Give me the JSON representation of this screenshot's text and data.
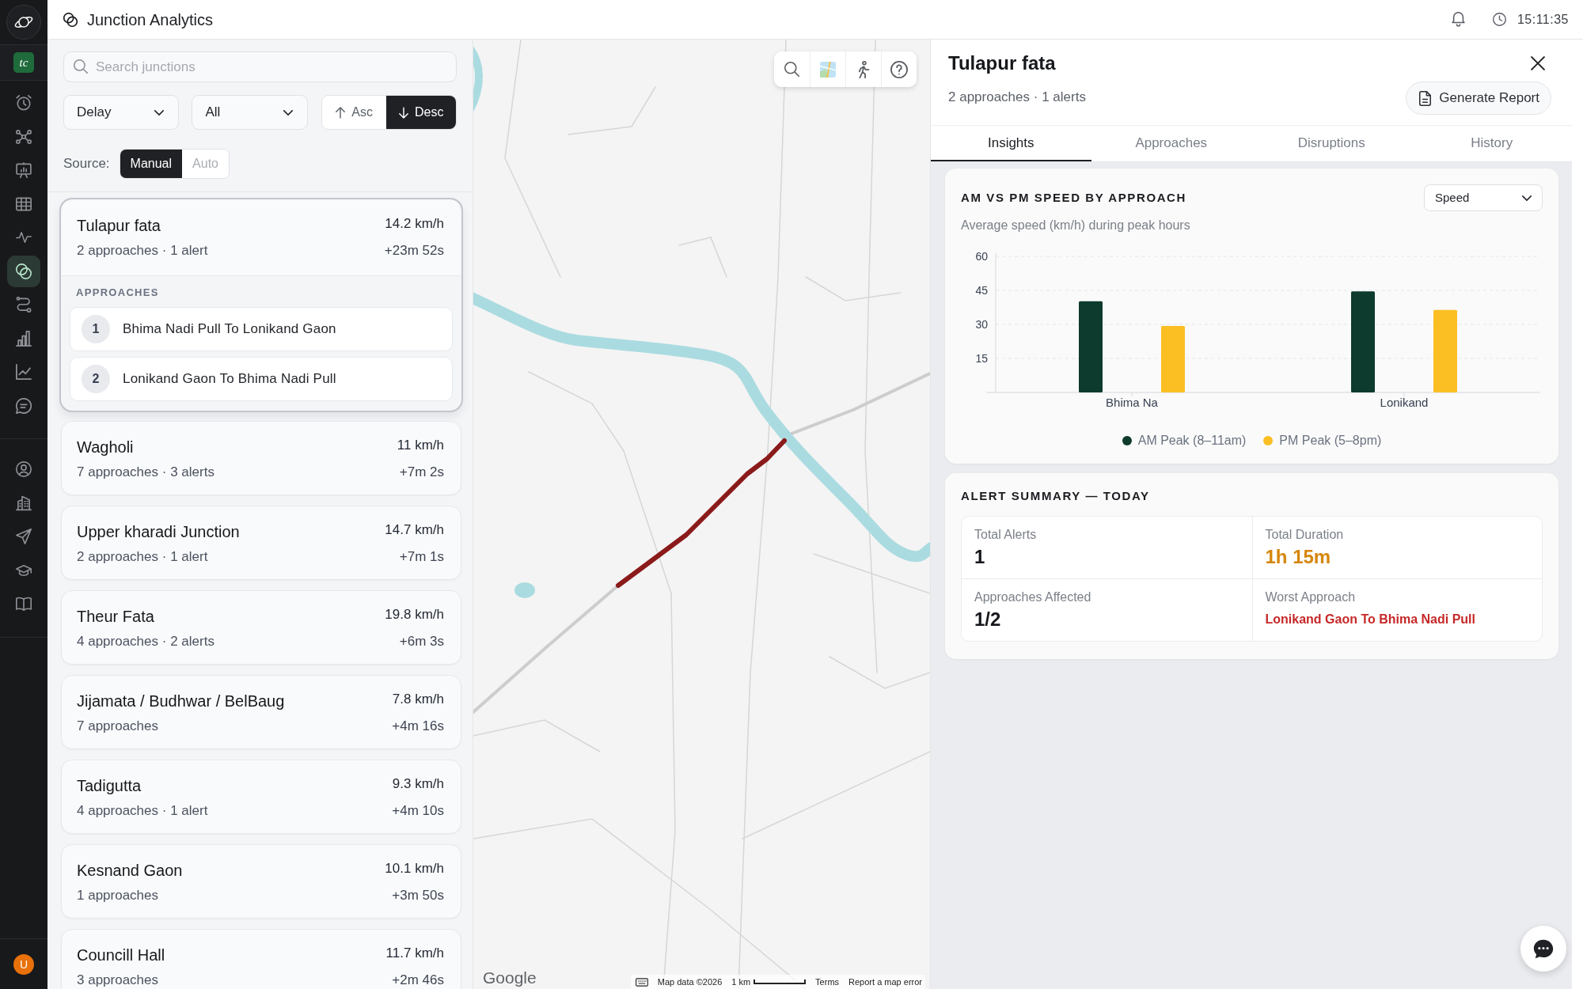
{
  "nav": {
    "workspace_badge": "tc",
    "groups": [
      {
        "items": [
          {
            "selected": false
          },
          {
            "selected": false
          },
          {
            "selected": false
          },
          {
            "selected": false
          },
          {
            "selected": false
          },
          {
            "selected": true
          },
          {
            "selected": false
          },
          {
            "selected": false
          },
          {
            "selected": false
          },
          {
            "selected": false
          }
        ]
      },
      {
        "items": [
          {
            "selected": false
          },
          {
            "selected": false
          },
          {
            "selected": false
          },
          {
            "selected": false
          },
          {
            "selected": false
          }
        ]
      }
    ],
    "avatar": "U"
  },
  "header": {
    "title": "Junction Analytics",
    "time": "15:11:35"
  },
  "junction_panel": {
    "search": {
      "placeholder": "Search junctions"
    },
    "filters": [
      {
        "value": "Delay"
      },
      {
        "value": "All"
      }
    ],
    "sort": [
      {
        "label": "Asc",
        "selected": false
      },
      {
        "label": "Desc",
        "selected": true
      }
    ],
    "source": {
      "label": "Source:",
      "options": [
        {
          "label": "Manual",
          "selected": true
        },
        {
          "label": "Auto",
          "selected": false
        }
      ]
    },
    "junctions": [
      {
        "name": "Tulapur fata",
        "summary": "2 approaches · 1 alert",
        "speed": "14.2 km/h",
        "delay": "+23m 52s",
        "selected": true,
        "approaches_heading": "APPROACHES",
        "approaches": [
          {
            "number": "1",
            "name": "Bhima Nadi Pull To Lonikand Gaon"
          },
          {
            "number": "2",
            "name": "Lonikand Gaon To Bhima Nadi Pull"
          }
        ]
      },
      {
        "name": "Wagholi",
        "summary": "7 approaches · 3 alerts",
        "speed": "11 km/h",
        "delay": "+7m 2s",
        "selected": false
      },
      {
        "name": "Upper kharadi Junction",
        "summary": "2 approaches · 1 alert",
        "speed": "14.7 km/h",
        "delay": "+7m 1s",
        "selected": false
      },
      {
        "name": "Theur Fata",
        "summary": "4 approaches · 2 alerts",
        "speed": "19.8 km/h",
        "delay": "+6m 3s",
        "selected": false
      },
      {
        "name": "Jijamata / Budhwar / BelBaug",
        "summary": "7 approaches",
        "speed": "7.8 km/h",
        "delay": "+4m 16s",
        "selected": false
      },
      {
        "name": "Tadigutta",
        "summary": "4 approaches · 1 alert",
        "speed": "9.3 km/h",
        "delay": "+4m 10s",
        "selected": false
      },
      {
        "name": "Kesnand Gaon",
        "summary": "1 approaches",
        "speed": "10.1 km/h",
        "delay": "+3m 50s",
        "selected": false
      },
      {
        "name": "Councill Hall",
        "summary": "3 approaches",
        "speed": "11.7 km/h",
        "delay": "+2m 46s",
        "selected": false
      }
    ]
  },
  "map": {
    "attribution": {
      "logo": "Google",
      "data_notice": "Map data ©2026",
      "scale": "1 km",
      "links": [
        "Terms",
        "Report a map error"
      ]
    }
  },
  "detail": {
    "title": "Tulapur fata",
    "subtitle": "2 approaches · 1 alerts",
    "report_button": "Generate Report",
    "tabs": [
      {
        "label": "Insights",
        "selected": true
      },
      {
        "label": "Approaches",
        "selected": false
      },
      {
        "label": "Disruptions",
        "selected": false
      },
      {
        "label": "History",
        "selected": false
      }
    ],
    "speed_card": {
      "title": "AM VS PM SPEED BY APPROACH",
      "subtitle": "Average speed (km/h) during peak hours",
      "metric": "Speed",
      "chart_data": {
        "type": "bar",
        "categories": [
          "Bhima Na",
          "Lonikand"
        ],
        "series": [
          {
            "name": "AM Peak (8–11am)",
            "color": "#0d3b2e",
            "values": [
              40.2,
              44.6
            ]
          },
          {
            "name": "PM Peak (5–8pm)",
            "color": "#fbbf24",
            "values": [
              29.3,
              36.4
            ]
          }
        ],
        "ylim": [
          0,
          60
        ],
        "yticks": [
          15,
          30,
          45,
          60
        ],
        "grid": true,
        "legend": true
      }
    },
    "alert_summary": {
      "title": "ALERT SUMMARY — TODAY",
      "stats": [
        {
          "label": "Total Alerts",
          "value": "1",
          "kind": "plain"
        },
        {
          "label": "Total Duration",
          "value": "1h 15m",
          "kind": "warning"
        },
        {
          "label": "Approaches Affected",
          "value": "1/2",
          "kind": "plain"
        },
        {
          "label": "Worst Approach",
          "value": "Lonikand Gaon To Bhima Nadi Pull",
          "kind": "danger"
        }
      ]
    }
  }
}
